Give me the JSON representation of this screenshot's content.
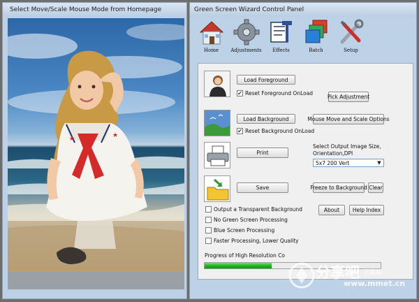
{
  "left_window": {
    "title": "Select Move/Scale Mouse Mode from Homepage"
  },
  "right_window": {
    "title": "Green Screen Wizard Control Panel"
  },
  "toolbar": {
    "items": [
      {
        "label": "Home",
        "icon": "house-icon"
      },
      {
        "label": "Adjustments",
        "icon": "gear-icon"
      },
      {
        "label": "Effects",
        "icon": "effects-icon"
      },
      {
        "label": "Batch",
        "icon": "layers-icon"
      },
      {
        "label": "Setup",
        "icon": "tools-icon"
      }
    ]
  },
  "panel": {
    "load_foreground": "Load Foreground",
    "reset_foreground": {
      "label": "Reset Foreground OnLoad",
      "checked": true
    },
    "pick_adjustment": "Pick Adjustment",
    "load_background": "Load Background",
    "reset_background": {
      "label": "Reset Background OnLoad",
      "checked": true
    },
    "mouse_move": "Mouse Move and Scale Options",
    "print": "Print",
    "output_size_label_1": "Select Output Image Size,",
    "output_size_label_2": "Orientation,DPI",
    "output_size_value": "5x7 200 Vert",
    "save": "Save",
    "freeze": "Freeze to Background",
    "clear": "Clear",
    "about": "About",
    "help_index": "Help Index",
    "options": [
      {
        "label": "Output a Transparent Background",
        "checked": false
      },
      {
        "label": "No Green Screen Processing",
        "checked": false
      },
      {
        "label": "Blue Screen Processing",
        "checked": false
      },
      {
        "label": "Faster Processing, Lower Quality",
        "checked": false
      }
    ]
  },
  "progress": {
    "label": "Progress of High Resolution Co",
    "value": 0.38
  },
  "watermark": {
    "text": "分享吧",
    "sub": "下载站",
    "url": "www.mmet.cn"
  },
  "colors": {
    "window_bg": "#bdd1e7",
    "panel_bg": "#f0f0f0",
    "progress_green": "#1eb51e",
    "desktop_bg": "#6e6e6e"
  }
}
